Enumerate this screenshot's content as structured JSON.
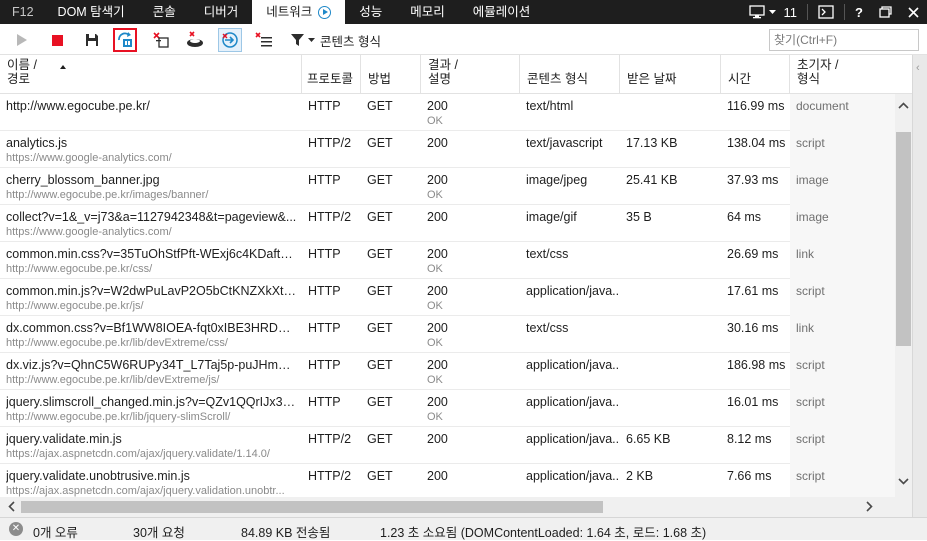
{
  "tabs": {
    "f12": "F12",
    "dom": "DOM 탐색기",
    "console": "콘솔",
    "debugger": "디버거",
    "network": "네트워크",
    "performance": "성능",
    "memory": "메모리",
    "emulation": "에뮬레이션"
  },
  "tabbar_right": {
    "monitor_icon": "monitor-icon",
    "count": "11",
    "console_icon": "console-prompt-icon",
    "help": "?",
    "restore_icon": "restore-window-icon",
    "close_icon": "close-icon"
  },
  "toolbar": {
    "start_icon": "start-profiling-icon",
    "stop_icon": "stop-profiling-icon",
    "export_icon": "export-har-icon",
    "always_refresh_icon": "always-refresh-from-server-icon",
    "clear_on_nav_icon": "clear-entries-on-navigate-icon",
    "clear_cache_icon": "clear-browser-cache-icon",
    "go_to_detail_icon": "go-to-detailed-view-icon",
    "clear_icon": "clear-session-icon",
    "filter_icon": "filter-icon",
    "filter_label": "콘텐츠 형식",
    "search_placeholder": "찾기(Ctrl+F)"
  },
  "columns": {
    "name": "이름 /\n경로",
    "protocol": "프로토콜",
    "method": "방법",
    "result": "결과 /\n설명",
    "type": "콘텐츠 형식",
    "received": "받은 날짜",
    "time": "시간",
    "initiator": "초기자 /\n형식"
  },
  "rows": [
    {
      "name": "http://www.egocube.pe.kr/",
      "path": "",
      "protocol": "HTTP",
      "method": "GET",
      "status": "200",
      "desc": "OK",
      "type": "text/html",
      "received": "",
      "time": "116.99 ms",
      "initiator": "document"
    },
    {
      "name": "analytics.js",
      "path": "https://www.google-analytics.com/",
      "protocol": "HTTP/2",
      "method": "GET",
      "status": "200",
      "desc": "",
      "type": "text/javascript",
      "received": "17.13 KB",
      "time": "138.04 ms",
      "initiator": "script"
    },
    {
      "name": "cherry_blossom_banner.jpg",
      "path": "http://www.egocube.pe.kr/images/banner/",
      "protocol": "HTTP",
      "method": "GET",
      "status": "200",
      "desc": "OK",
      "type": "image/jpeg",
      "received": "25.41 KB",
      "time": "37.93 ms",
      "initiator": "image"
    },
    {
      "name": "collect?v=1&_v=j73&a=1127942348&t=pageview&...",
      "path": "https://www.google-analytics.com/",
      "protocol": "HTTP/2",
      "method": "GET",
      "status": "200",
      "desc": "",
      "type": "image/gif",
      "received": "35 B",
      "time": "64 ms",
      "initiator": "image"
    },
    {
      "name": "common.min.css?v=35TuOhStfPft-WExj6c4KDaftuD...",
      "path": "http://www.egocube.pe.kr/css/",
      "protocol": "HTTP",
      "method": "GET",
      "status": "200",
      "desc": "OK",
      "type": "text/css",
      "received": "",
      "time": "26.69 ms",
      "initiator": "link"
    },
    {
      "name": "common.min.js?v=W2dwPuLavP2O5bCtKNZXkXtFf...",
      "path": "http://www.egocube.pe.kr/js/",
      "protocol": "HTTP",
      "method": "GET",
      "status": "200",
      "desc": "OK",
      "type": "application/java...",
      "received": "",
      "time": "17.61 ms",
      "initiator": "script"
    },
    {
      "name": "dx.common.css?v=Bf1WW8IOEA-fqt0xIBE3HRDSdT...",
      "path": "http://www.egocube.pe.kr/lib/devExtreme/css/",
      "protocol": "HTTP",
      "method": "GET",
      "status": "200",
      "desc": "OK",
      "type": "text/css",
      "received": "",
      "time": "30.16 ms",
      "initiator": "link"
    },
    {
      "name": "dx.viz.js?v=QhnC5W6RUPy34T_L7Taj5p-puJHmYUO...",
      "path": "http://www.egocube.pe.kr/lib/devExtreme/js/",
      "protocol": "HTTP",
      "method": "GET",
      "status": "200",
      "desc": "OK",
      "type": "application/java...",
      "received": "",
      "time": "186.98 ms",
      "initiator": "script"
    },
    {
      "name": "jquery.slimscroll_changed.min.js?v=QZv1QQrIJx3ovj...",
      "path": "http://www.egocube.pe.kr/lib/jquery-slimScroll/",
      "protocol": "HTTP",
      "method": "GET",
      "status": "200",
      "desc": "OK",
      "type": "application/java...",
      "received": "",
      "time": "16.01 ms",
      "initiator": "script"
    },
    {
      "name": "jquery.validate.min.js",
      "path": "https://ajax.aspnetcdn.com/ajax/jquery.validate/1.14.0/",
      "protocol": "HTTP/2",
      "method": "GET",
      "status": "200",
      "desc": "",
      "type": "application/java...",
      "received": "6.65 KB",
      "time": "8.12 ms",
      "initiator": "script"
    },
    {
      "name": "jquery.validate.unobtrusive.min.js",
      "path": "https://ajax.aspnetcdn.com/ajax/jquery.validation.unobtr...",
      "protocol": "HTTP/2",
      "method": "GET",
      "status": "200",
      "desc": "",
      "type": "application/java...",
      "received": "2 KB",
      "time": "7.66 ms",
      "initiator": "script"
    }
  ],
  "status": {
    "errors": "0개 오류",
    "requests": "30개 요청",
    "transferred": "84.89 KB 전송됨",
    "timing": "1.23 초 소요됨 (DOMContentLoaded: 1.64 초, 로드: 1.68 초)"
  },
  "colors": {
    "tabbar_bg": "#1e1e1e",
    "accent_blue": "#1e88c8",
    "stop_red": "#e81123",
    "highlight_border": "#e81123"
  }
}
